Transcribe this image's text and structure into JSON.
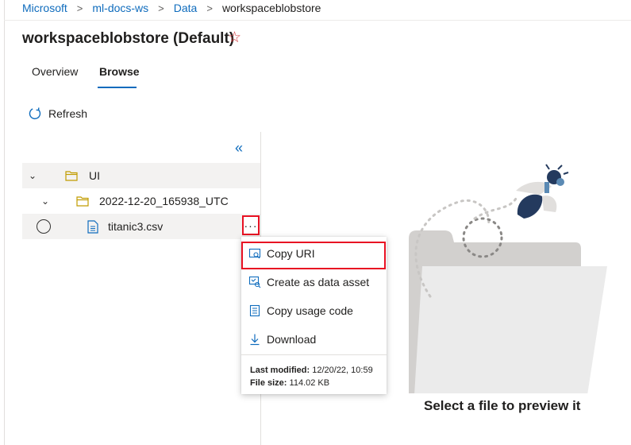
{
  "breadcrumb": {
    "items": [
      "Microsoft",
      "ml-docs-ws",
      "Data"
    ],
    "current": "workspaceblobstore"
  },
  "page": {
    "title": "workspaceblobstore (Default)",
    "star_icon": "star-icon"
  },
  "tabs": [
    {
      "label": "Overview",
      "selected": false
    },
    {
      "label": "Browse",
      "selected": true
    }
  ],
  "toolbar": {
    "refresh_label": "Refresh",
    "refresh_icon": "refresh-icon"
  },
  "tree": {
    "collapse_icon": "double-chevron-left-icon",
    "nodes": [
      {
        "label": "UI",
        "type": "folder",
        "expanded": true
      },
      {
        "label": "2022-12-20_165938_UTC",
        "type": "folder",
        "expanded": true
      },
      {
        "label": "titanic3.csv",
        "type": "file"
      }
    ],
    "more_button": "···"
  },
  "context_menu": {
    "items": [
      {
        "label": "Copy URI",
        "icon": "copy-uri-icon"
      },
      {
        "label": "Create as data asset",
        "icon": "data-asset-icon"
      },
      {
        "label": "Copy usage code",
        "icon": "usage-code-icon"
      },
      {
        "label": "Download",
        "icon": "download-icon"
      }
    ],
    "last_modified_label": "Last modified:",
    "last_modified_value": "12/20/22, 10:59",
    "file_size_label": "File size:",
    "file_size_value": "114.02 KB"
  },
  "preview": {
    "empty_message": "Select a file to preview it"
  },
  "colors": {
    "accent": "#0f6cbd",
    "highlight": "#e81123",
    "folder": "#c19c00",
    "star": "#d13438"
  }
}
